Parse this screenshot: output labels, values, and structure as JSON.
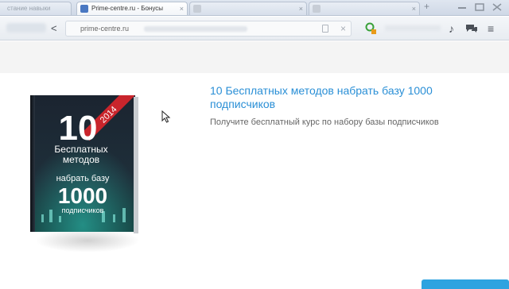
{
  "browser": {
    "tabs": [
      {
        "label": "стание навыки",
        "active": false
      },
      {
        "label": "Prime-centre.ru - Бонусы",
        "active": true
      },
      {
        "label": "",
        "active": false
      },
      {
        "label": "",
        "active": false
      }
    ],
    "address_url": "prime-centre.ru"
  },
  "offer": {
    "title": "10 Бесплатных методов набрать базу 1000 подписчиков",
    "subtitle": "Получите бесплатный курс по набору базы подписчиков"
  },
  "book_cover": {
    "number": "10",
    "line1": "Бесплатных",
    "line2": "методов",
    "line3": "набрать базу",
    "big_number": "1000",
    "line4": "подписчиков",
    "year": "2014"
  },
  "colors": {
    "link": "#2a8fd6",
    "button": "#2ea3e0",
    "book_ribbon": "#c9252c"
  }
}
